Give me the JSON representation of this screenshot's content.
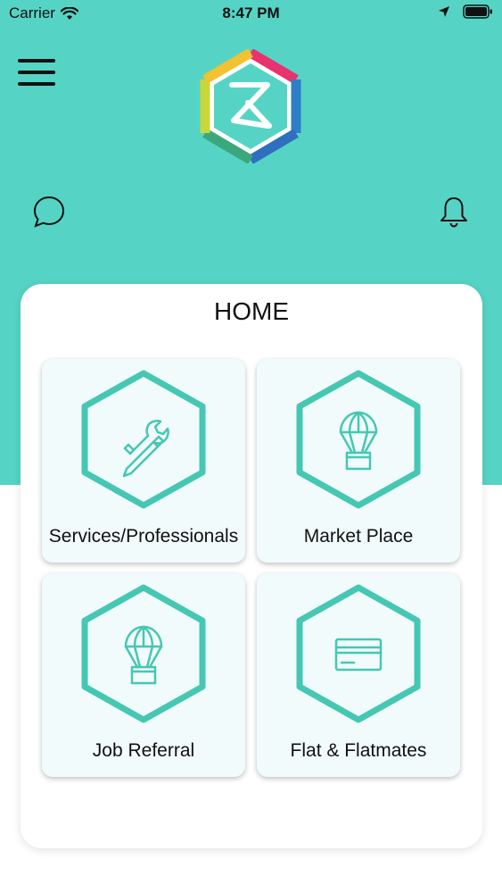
{
  "status_bar": {
    "carrier": "Carrier",
    "time": "8:47 PM"
  },
  "header": {
    "menu_icon": "hamburger-icon",
    "logo": "app-logo",
    "chat_icon": "chat-bubble-icon",
    "bell_icon": "bell-icon"
  },
  "home": {
    "title": "HOME",
    "tiles": [
      {
        "label": "Services/Professionals",
        "icon": "tools-icon"
      },
      {
        "label": "Market Place",
        "icon": "parachute-box-icon"
      },
      {
        "label": "Job Referral",
        "icon": "parachute-box-icon"
      },
      {
        "label": "Flat & Flatmates",
        "icon": "card-icon"
      }
    ]
  },
  "colors": {
    "accent": "#55d4c5",
    "tile_bg": "#f1fbfb",
    "icon_stroke": "#45c7b4"
  }
}
